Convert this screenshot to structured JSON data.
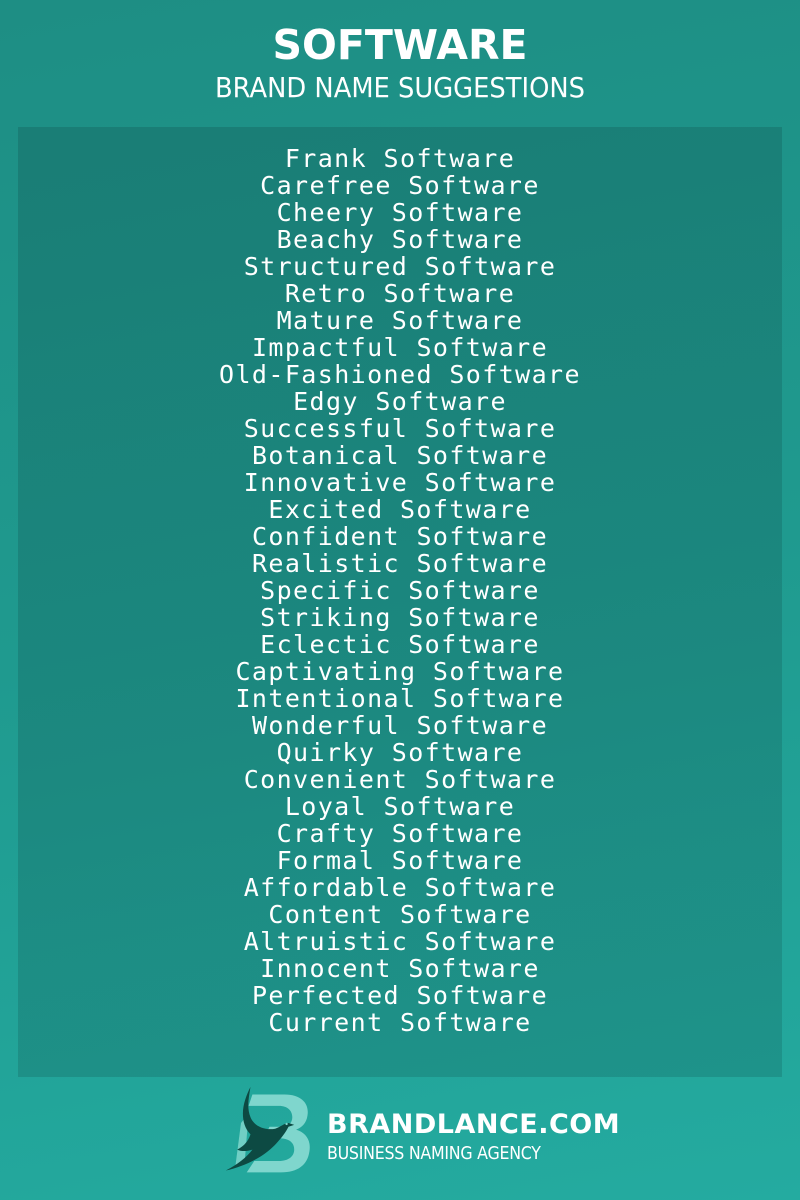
{
  "header": {
    "title": "SOFTWARE",
    "subtitle": "BRAND NAME SUGGESTIONS"
  },
  "names": [
    "Frank Software",
    "Carefree Software",
    "Cheery Software",
    "Beachy Software",
    "Structured Software",
    "Retro Software",
    "Mature Software",
    "Impactful Software",
    "Old-Fashioned Software",
    "Edgy Software",
    "Successful Software",
    "Botanical Software",
    "Innovative Software",
    "Excited Software",
    "Confident Software",
    "Realistic Software",
    "Specific Software",
    "Striking Software",
    "Eclectic Software",
    "Captivating Software",
    "Intentional Software",
    "Wonderful Software",
    "Quirky Software",
    "Convenient Software",
    "Loyal Software",
    "Crafty Software",
    "Formal Software",
    "Affordable Software",
    "Content Software",
    "Altruistic Software",
    "Innocent Software",
    "Perfected Software",
    "Current Software"
  ],
  "footer": {
    "logo_icon": "brandlance-bird-b-logo",
    "brand": "BRANDLANCE.COM",
    "tagline": "BUSINESS NAMING AGENCY"
  },
  "colors": {
    "background_top": "#1e8e84",
    "background_bottom": "#24aba0",
    "panel": "#1b8077",
    "text": "#ffffff",
    "logo_dark": "#0d4a43",
    "logo_light": "#7fd6cd"
  }
}
